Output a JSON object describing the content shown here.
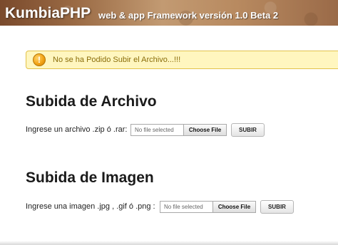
{
  "header": {
    "logo": "KumbiaPHP",
    "tagline": "web & app Framework versión 1.0 Beta 2"
  },
  "alert": {
    "icon": "exclamation-icon",
    "icon_glyph": "!",
    "text": "No se ha Podido Subir el Archivo...!!!",
    "background": "#fff6bf",
    "border": "#e2c24a",
    "text_color": "#8a6d0a"
  },
  "archivo": {
    "title": "Subida de Archivo",
    "label": "Ingrese un archivo .zip ó .rar:",
    "file_status": "No file selected",
    "choose_label": "Choose File",
    "submit_label": "SUBIR"
  },
  "imagen": {
    "title": "Subida de Imagen",
    "label": "Ingrese una imagen .jpg , .gif ó .png :",
    "file_status": "No file selected",
    "choose_label": "Choose File",
    "submit_label": "SUBIR"
  }
}
